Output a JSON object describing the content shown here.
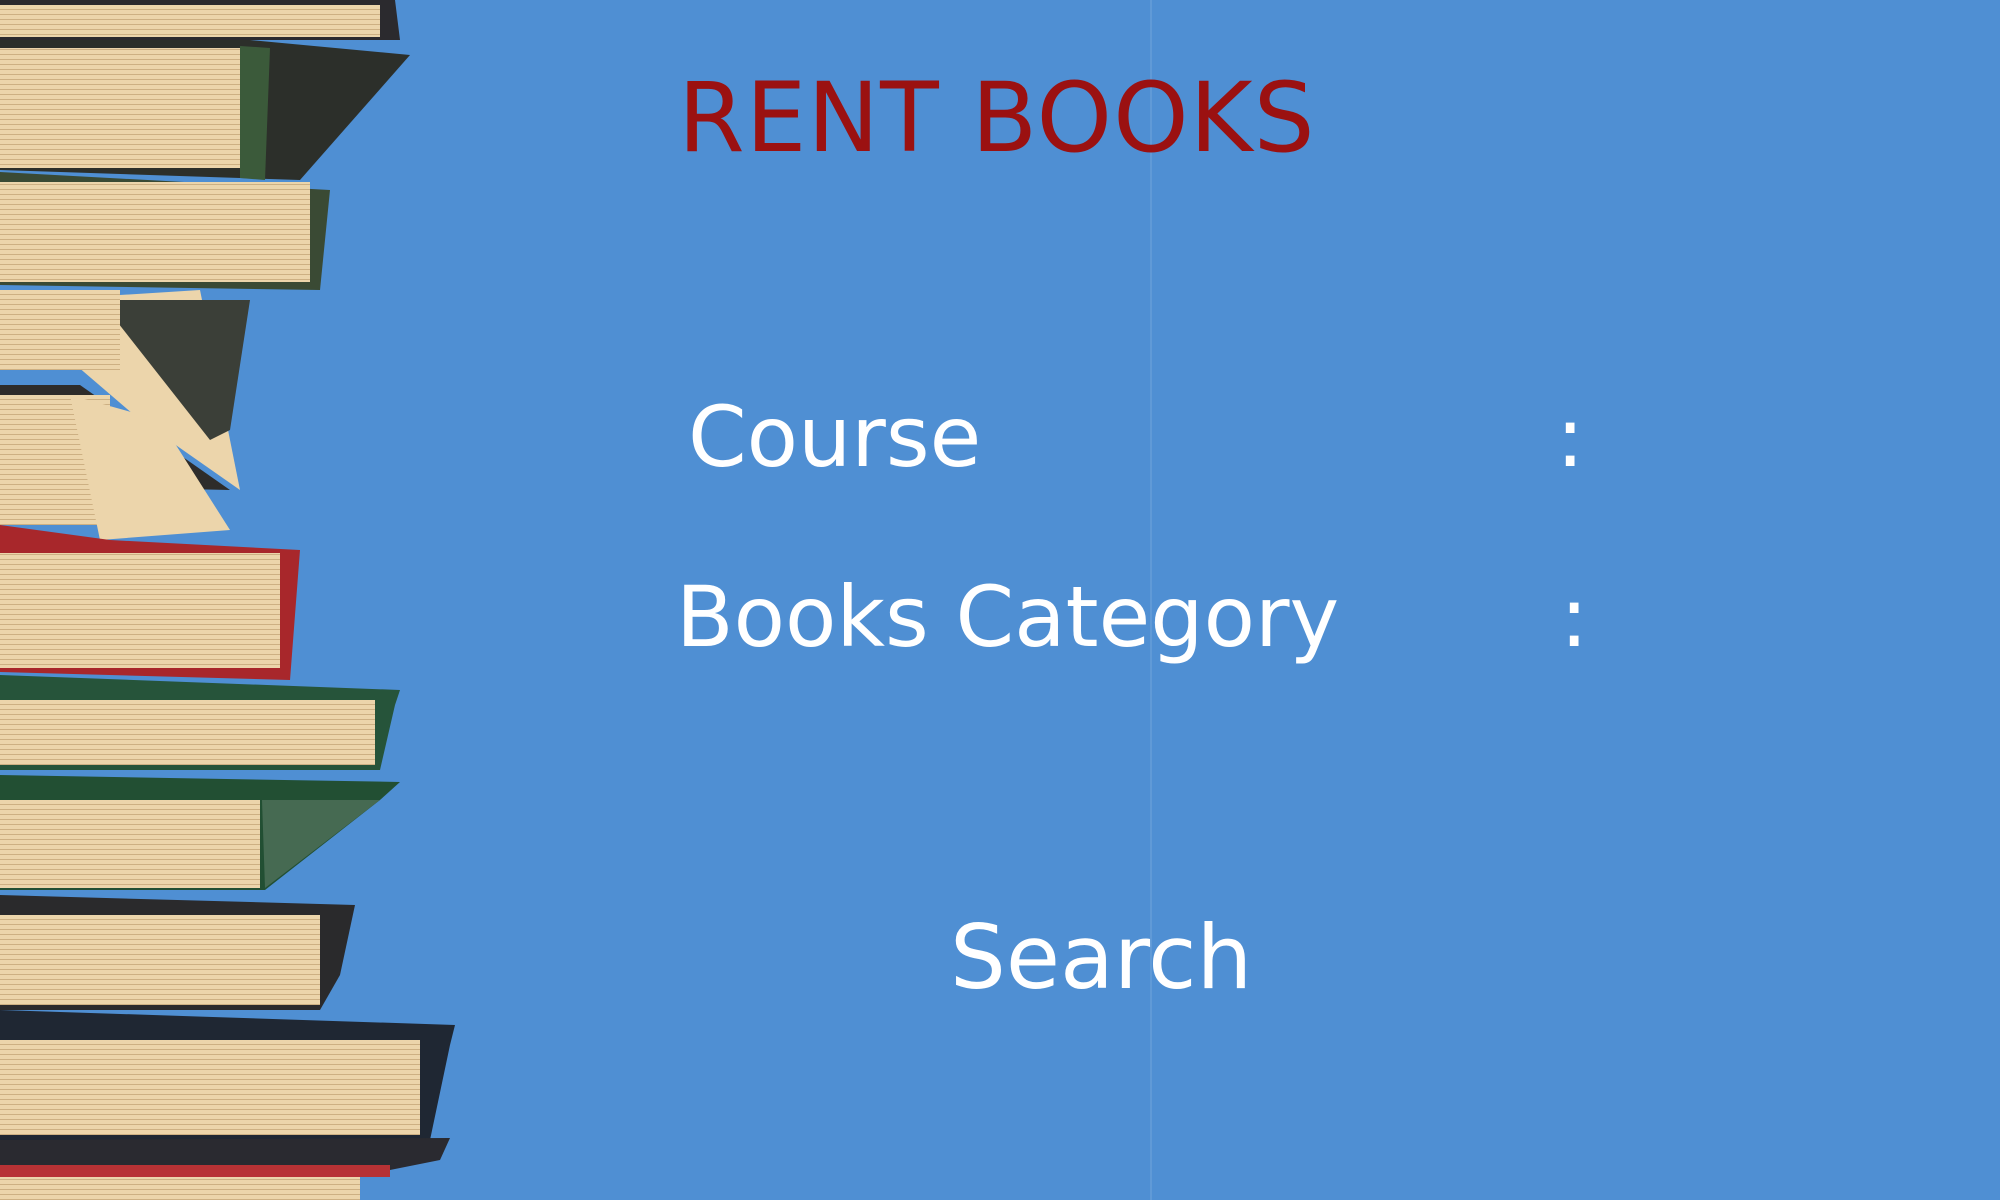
{
  "page": {
    "title": "RENT BOOKS"
  },
  "form": {
    "course_label": "Course",
    "course_separator": ":",
    "category_label": "Books Category",
    "category_separator": ":",
    "search_label": "Search"
  },
  "colors": {
    "background": "#4f8fd3",
    "title": "#9b1111",
    "label": "#ffffff"
  },
  "illustration": {
    "icon": "book-stack-icon"
  }
}
